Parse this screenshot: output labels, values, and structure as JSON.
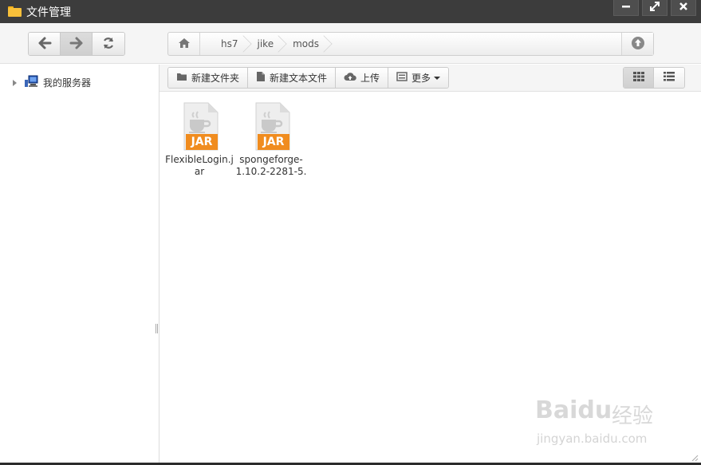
{
  "window": {
    "title": "文件管理",
    "controls": [
      {
        "name": "minimize-icon",
        "glyph": "▬"
      },
      {
        "name": "maximize-icon",
        "glyph": "⤢"
      },
      {
        "name": "close-icon",
        "glyph": "✖"
      }
    ]
  },
  "nav": {
    "breadcrumb": [
      "hs7",
      "jike",
      "mods"
    ]
  },
  "sidebar": {
    "tree": [
      {
        "label": "我的服务器"
      }
    ]
  },
  "toolbar": {
    "new_folder": "新建文件夹",
    "new_text_file": "新建文本文件",
    "upload": "上传",
    "more": "更多"
  },
  "files": [
    {
      "name": "FlexibleLogin.jar",
      "badge": "JAR"
    },
    {
      "name": "spongeforge-1.10.2-2281-5.",
      "badge": "JAR"
    }
  ],
  "watermark": {
    "brand": "Baidu",
    "suffix": "经验",
    "url": "jingyan.baidu.com"
  },
  "colors": {
    "titlebar": "#3c3c3c",
    "jar_orange": "#f08c1f",
    "folder": "#f8c03a"
  }
}
